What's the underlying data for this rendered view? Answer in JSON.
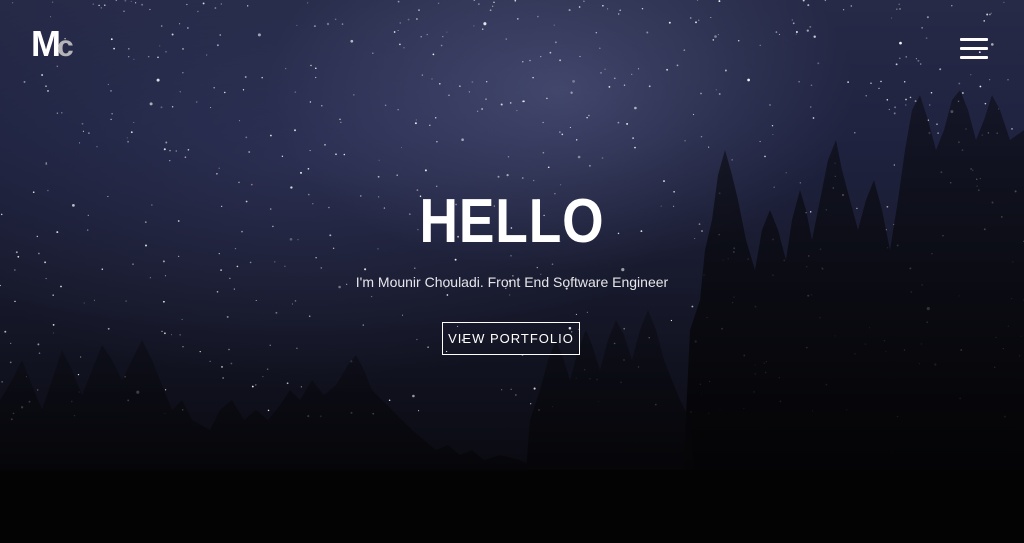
{
  "header": {
    "logo": {
      "letter_m": "M",
      "letter_c": "c",
      "colors": {
        "m": "#ffffff",
        "c": "#b5b5b8"
      }
    },
    "menu_icon": "hamburger-menu-icon"
  },
  "hero": {
    "title": "HELLO",
    "subtitle": "I'm Mounir Chouladi. Front End Software Engineer",
    "cta_label": "VIEW PORTFOLIO",
    "background": "night-sky-with-stars-and-pine-tree-silhouettes",
    "colors": {
      "sky_top": "#262a47",
      "sky_bottom": "#050507",
      "text": "#ffffff"
    }
  }
}
